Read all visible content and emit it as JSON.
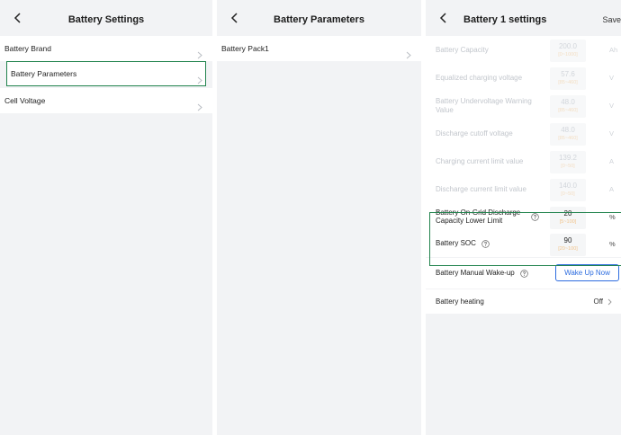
{
  "panel1": {
    "title": "Battery Settings",
    "items": [
      {
        "label": "Battery Brand"
      },
      {
        "label": "Battery Parameters"
      },
      {
        "label": "Cell Voltage"
      }
    ]
  },
  "panel2": {
    "title": "Battery Parameters",
    "items": [
      {
        "label": "Battery Pack1"
      }
    ]
  },
  "panel3": {
    "title": "Battery 1 settings",
    "save_label": "Save",
    "rows": [
      {
        "label": "Battery Capacity",
        "value": "200.0",
        "range": "[0~1000]",
        "unit": "Ah"
      },
      {
        "label": "Equalized charging voltage",
        "value": "57.6",
        "range": "[85~460]",
        "unit": "V"
      },
      {
        "label": "Battery Undervoltage Warning Value",
        "value": "48.0",
        "range": "[85~460]",
        "unit": "V"
      },
      {
        "label": "Discharge cutoff voltage",
        "value": "48.0",
        "range": "[85~460]",
        "unit": "V"
      },
      {
        "label": "Charging current limit value",
        "value": "139.2",
        "range": "[0~50]",
        "unit": "A"
      },
      {
        "label": "Discharge current limit value",
        "value": "140.0",
        "range": "[0~50]",
        "unit": "A"
      },
      {
        "label": "Battery On-Grid Discharge Capacity Lower Limit",
        "value": "20",
        "range": "[5~100]",
        "unit": "%"
      },
      {
        "label": "Battery SOC",
        "value": "90",
        "range": "[20~100]",
        "unit": "%"
      }
    ],
    "wake": {
      "label": "Battery Manual Wake-up",
      "button": "Wake Up Now"
    },
    "heating": {
      "label": "Battery heating",
      "value": "Off"
    }
  },
  "colors": {
    "accent_green": "#21834d",
    "link_blue": "#2d6cdf",
    "range_orange": "#f1c38a"
  },
  "icons": [
    "back-arrow-icon",
    "chevron-right-icon",
    "help-circle-icon"
  ]
}
